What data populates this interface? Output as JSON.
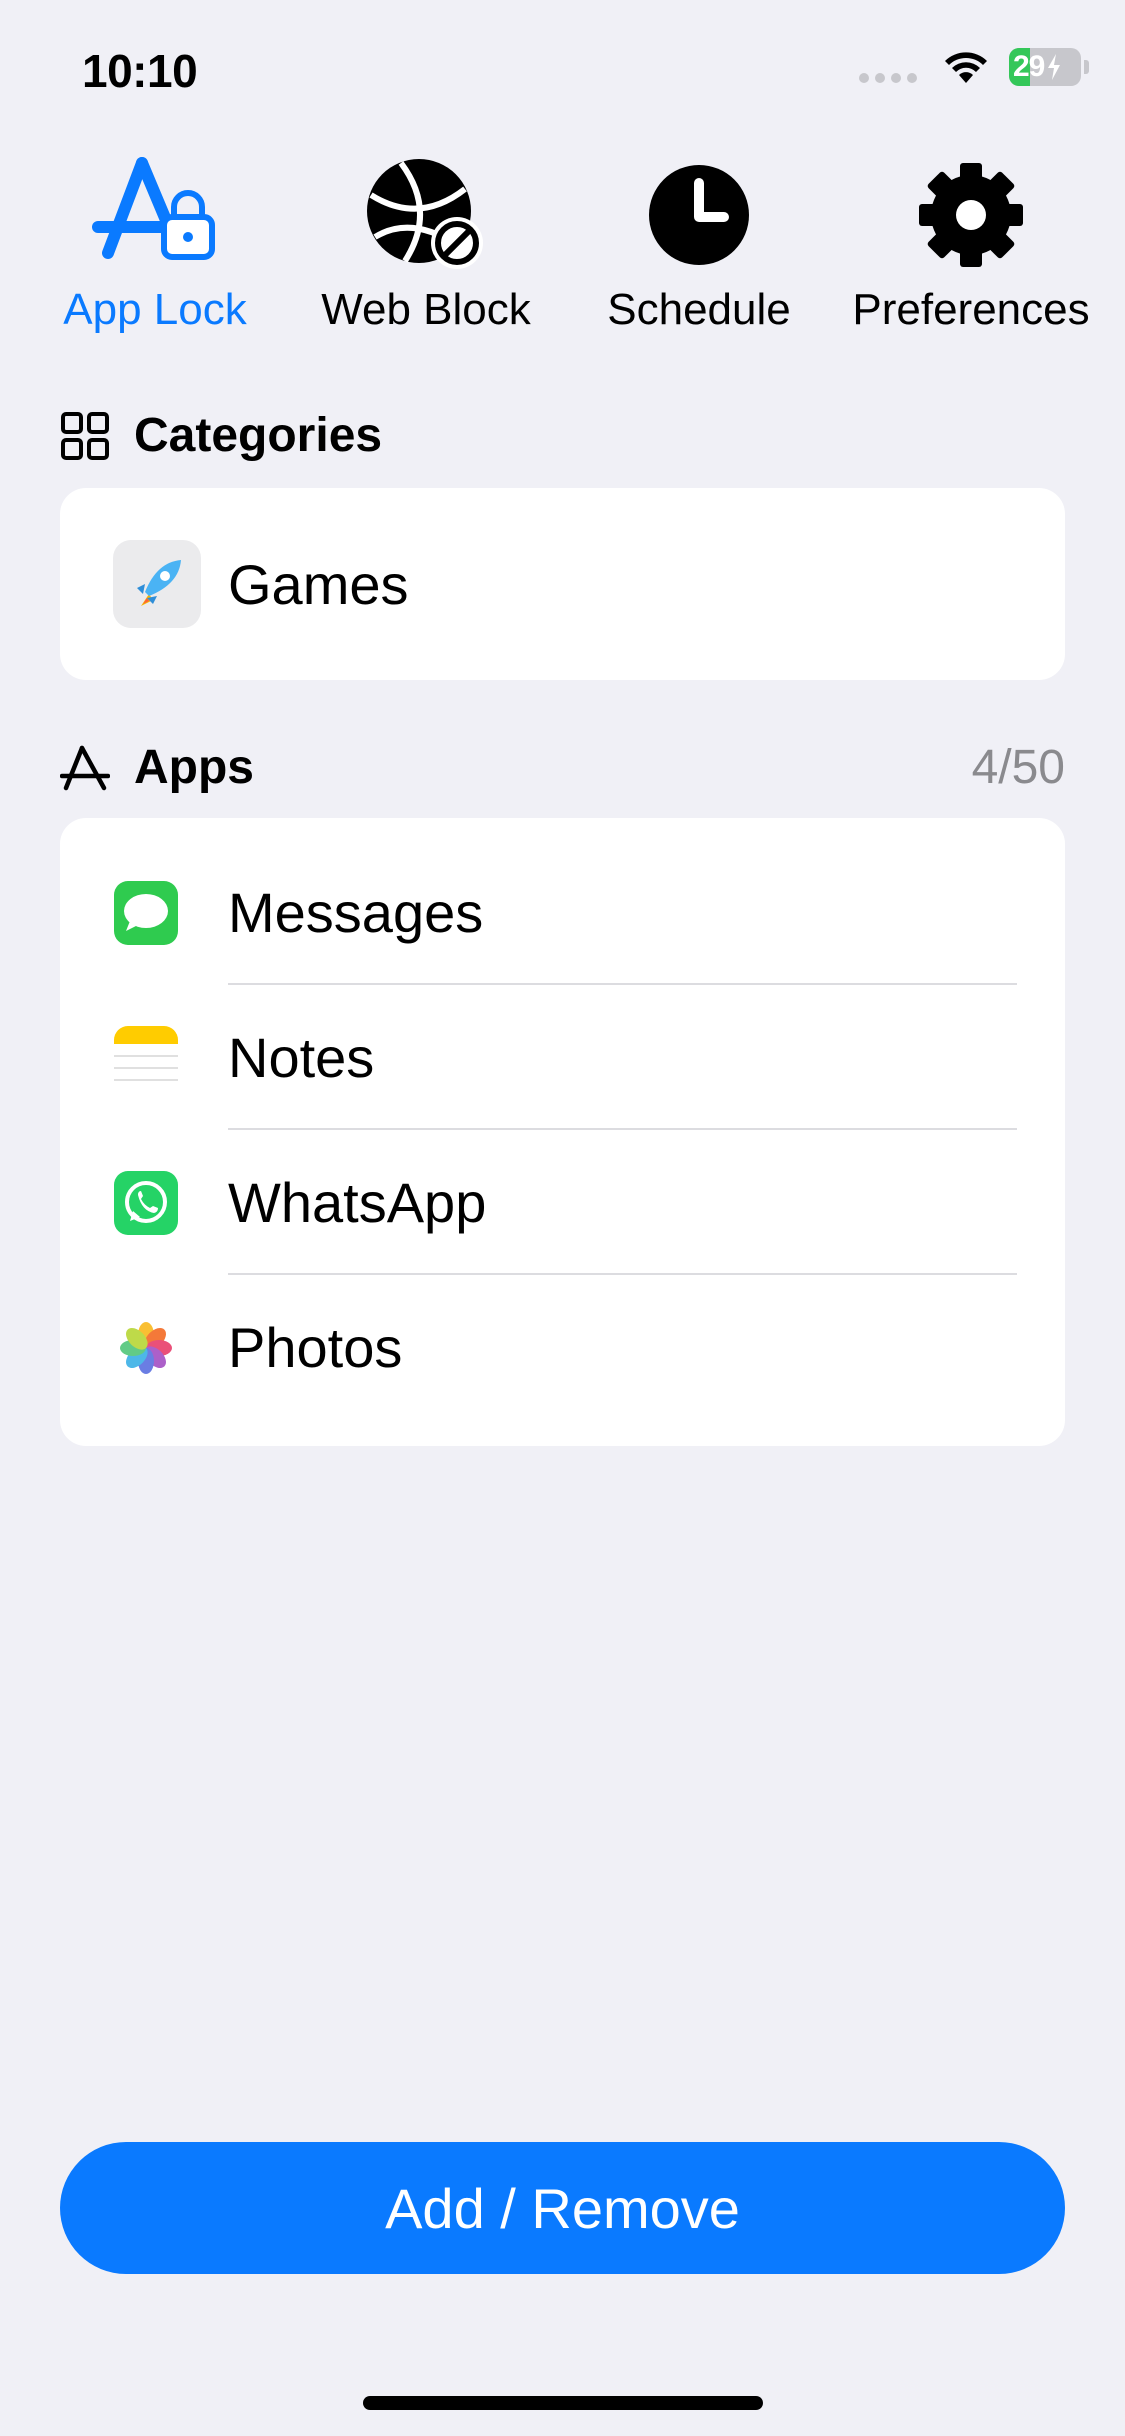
{
  "status_bar": {
    "time": "10:10",
    "battery_level": "29",
    "battery_fraction": 0.29
  },
  "tabs": [
    {
      "label": "App Lock",
      "icon": "app-lock-icon",
      "active": true
    },
    {
      "label": "Web Block",
      "icon": "globe-block-icon",
      "active": false
    },
    {
      "label": "Schedule",
      "icon": "clock-icon",
      "active": false
    },
    {
      "label": "Preferences",
      "icon": "gear-icon",
      "active": false
    }
  ],
  "categories": {
    "title": "Categories",
    "icon": "grid-icon",
    "items": [
      {
        "label": "Games",
        "icon": "rocket-icon"
      }
    ]
  },
  "apps": {
    "title": "Apps",
    "icon": "app-store-icon",
    "count": "4/50",
    "items": [
      {
        "label": "Messages",
        "icon": "messages-icon"
      },
      {
        "label": "Notes",
        "icon": "notes-icon"
      },
      {
        "label": "WhatsApp",
        "icon": "whatsapp-icon"
      },
      {
        "label": "Photos",
        "icon": "photos-icon"
      }
    ]
  },
  "actions": {
    "add_remove_label": "Add / Remove"
  },
  "colors": {
    "accent": "#0a7aff",
    "background": "#f0f0f6",
    "battery": "#34c759"
  }
}
